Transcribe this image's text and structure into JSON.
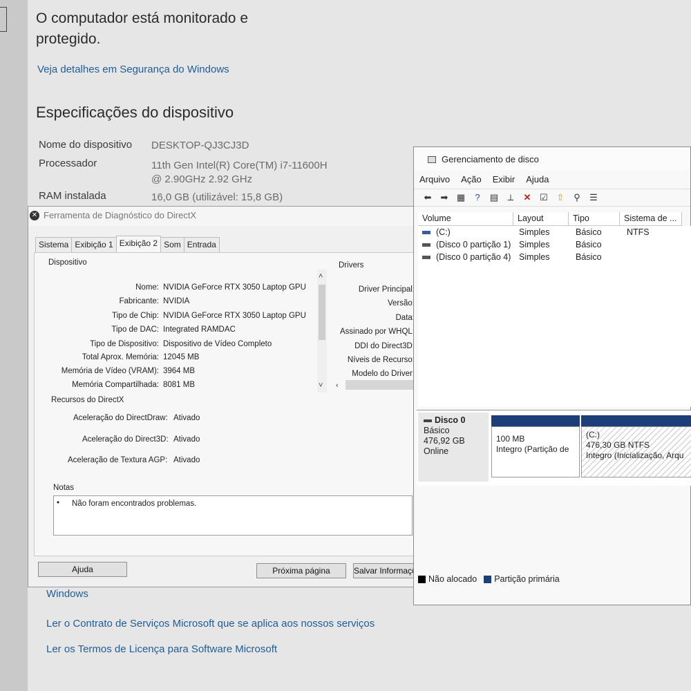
{
  "security": {
    "status_title": "O computador está monitorado e protegido.",
    "details_link": "Veja detalhes em Segurança do Windows"
  },
  "specs": {
    "heading": "Especificações do dispositivo",
    "rows": [
      {
        "label": "Nome do dispositivo",
        "value": "DESKTOP-QJ3CJ3D"
      },
      {
        "label": "Processador",
        "value": "11th Gen Intel(R) Core(TM) i7-11600H @ 2.90GHz   2.92 GHz"
      },
      {
        "label": "RAM instalada",
        "value": "16,0 GB (utilizável: 15,8 GB)"
      }
    ]
  },
  "links": {
    "windows": "Windows",
    "contract": "Ler o Contrato de Serviços Microsoft que se aplica aos nossos serviços",
    "license": "Ler os Termos de Licença para Software Microsoft"
  },
  "dxdiag": {
    "title": "Ferramenta de Diagnóstico do DirectX",
    "tabs": [
      "Sistema",
      "Exibição 1",
      "Exibição 2",
      "Som",
      "Entrada"
    ],
    "active_tab": "Exibição 2",
    "device_group": "Dispositivo",
    "device": [
      {
        "label": "Nome:",
        "value": "NVIDIA GeForce RTX 3050 Laptop GPU"
      },
      {
        "label": "Fabricante:",
        "value": "NVIDIA"
      },
      {
        "label": "Tipo de Chip:",
        "value": "NVIDIA GeForce RTX 3050 Laptop GPU"
      },
      {
        "label": "Tipo de DAC:",
        "value": "Integrated RAMDAC"
      },
      {
        "label": "Tipo de Dispositivo:",
        "value": "Dispositivo de Vídeo Completo"
      },
      {
        "label": "Total Aprox. Memória:",
        "value": "12045 MB"
      },
      {
        "label": "Memória de Vídeo (VRAM):",
        "value": "3964 MB"
      },
      {
        "label": "Memória Compartilhada:",
        "value": "8081 MB"
      }
    ],
    "drivers_group": "Drivers",
    "drivers": [
      "Driver Principal:",
      "Versão:",
      "Data:",
      "Assinado por WHQL:",
      "DDI do Direct3D:",
      "Níveis de Recurso:",
      "Modelo do Driver:"
    ],
    "features_group": "Recursos do DirectX",
    "features": [
      {
        "label": "Aceleração do DirectDraw:",
        "value": "Ativado"
      },
      {
        "label": "Aceleração do Direct3D:",
        "value": "Ativado"
      },
      {
        "label": "Aceleração de Textura AGP:",
        "value": "Ativado"
      }
    ],
    "notes_group": "Notas",
    "notes_bullet": "•",
    "notes": "Não foram encontrados problemas.",
    "buttons": {
      "help": "Ajuda",
      "next": "Próxima página",
      "save": "Salvar Informações..."
    }
  },
  "diskmgmt": {
    "title": "Gerenciamento de disco",
    "menu": [
      "Arquivo",
      "Ação",
      "Exibir",
      "Ajuda"
    ],
    "toolbar_icons": [
      "back-icon",
      "forward-icon",
      "up-icon",
      "help-icon",
      "properties-icon",
      "connect-icon",
      "delete-icon",
      "check-icon",
      "import-icon",
      "search-icon",
      "list-icon"
    ],
    "columns": [
      "Volume",
      "Layout",
      "Tipo",
      "Sistema de ..."
    ],
    "volumes": [
      {
        "volume": "(C:)",
        "layout": "Simples",
        "tipo": "Básico",
        "fs": "NTFS"
      },
      {
        "volume": "(Disco 0 partição 1)",
        "layout": "Simples",
        "tipo": "Básico",
        "fs": ""
      },
      {
        "volume": "(Disco 0 partição 4)",
        "layout": "Simples",
        "tipo": "Básico",
        "fs": ""
      }
    ],
    "disk": {
      "name": "Disco 0",
      "type": "Básico",
      "size": "476,92 GB",
      "status": "Online"
    },
    "partitions": [
      {
        "label": "",
        "size": "100 MB",
        "status": "Integro (Partição de"
      },
      {
        "label": "(C:)",
        "size": "476,30 GB NTFS",
        "status": "Integro (Inicialização, Arqu"
      }
    ],
    "legend": [
      {
        "label": "Não alocado",
        "color": "#000000"
      },
      {
        "label": "Partição primária",
        "color": "#1c3f7a"
      }
    ]
  }
}
